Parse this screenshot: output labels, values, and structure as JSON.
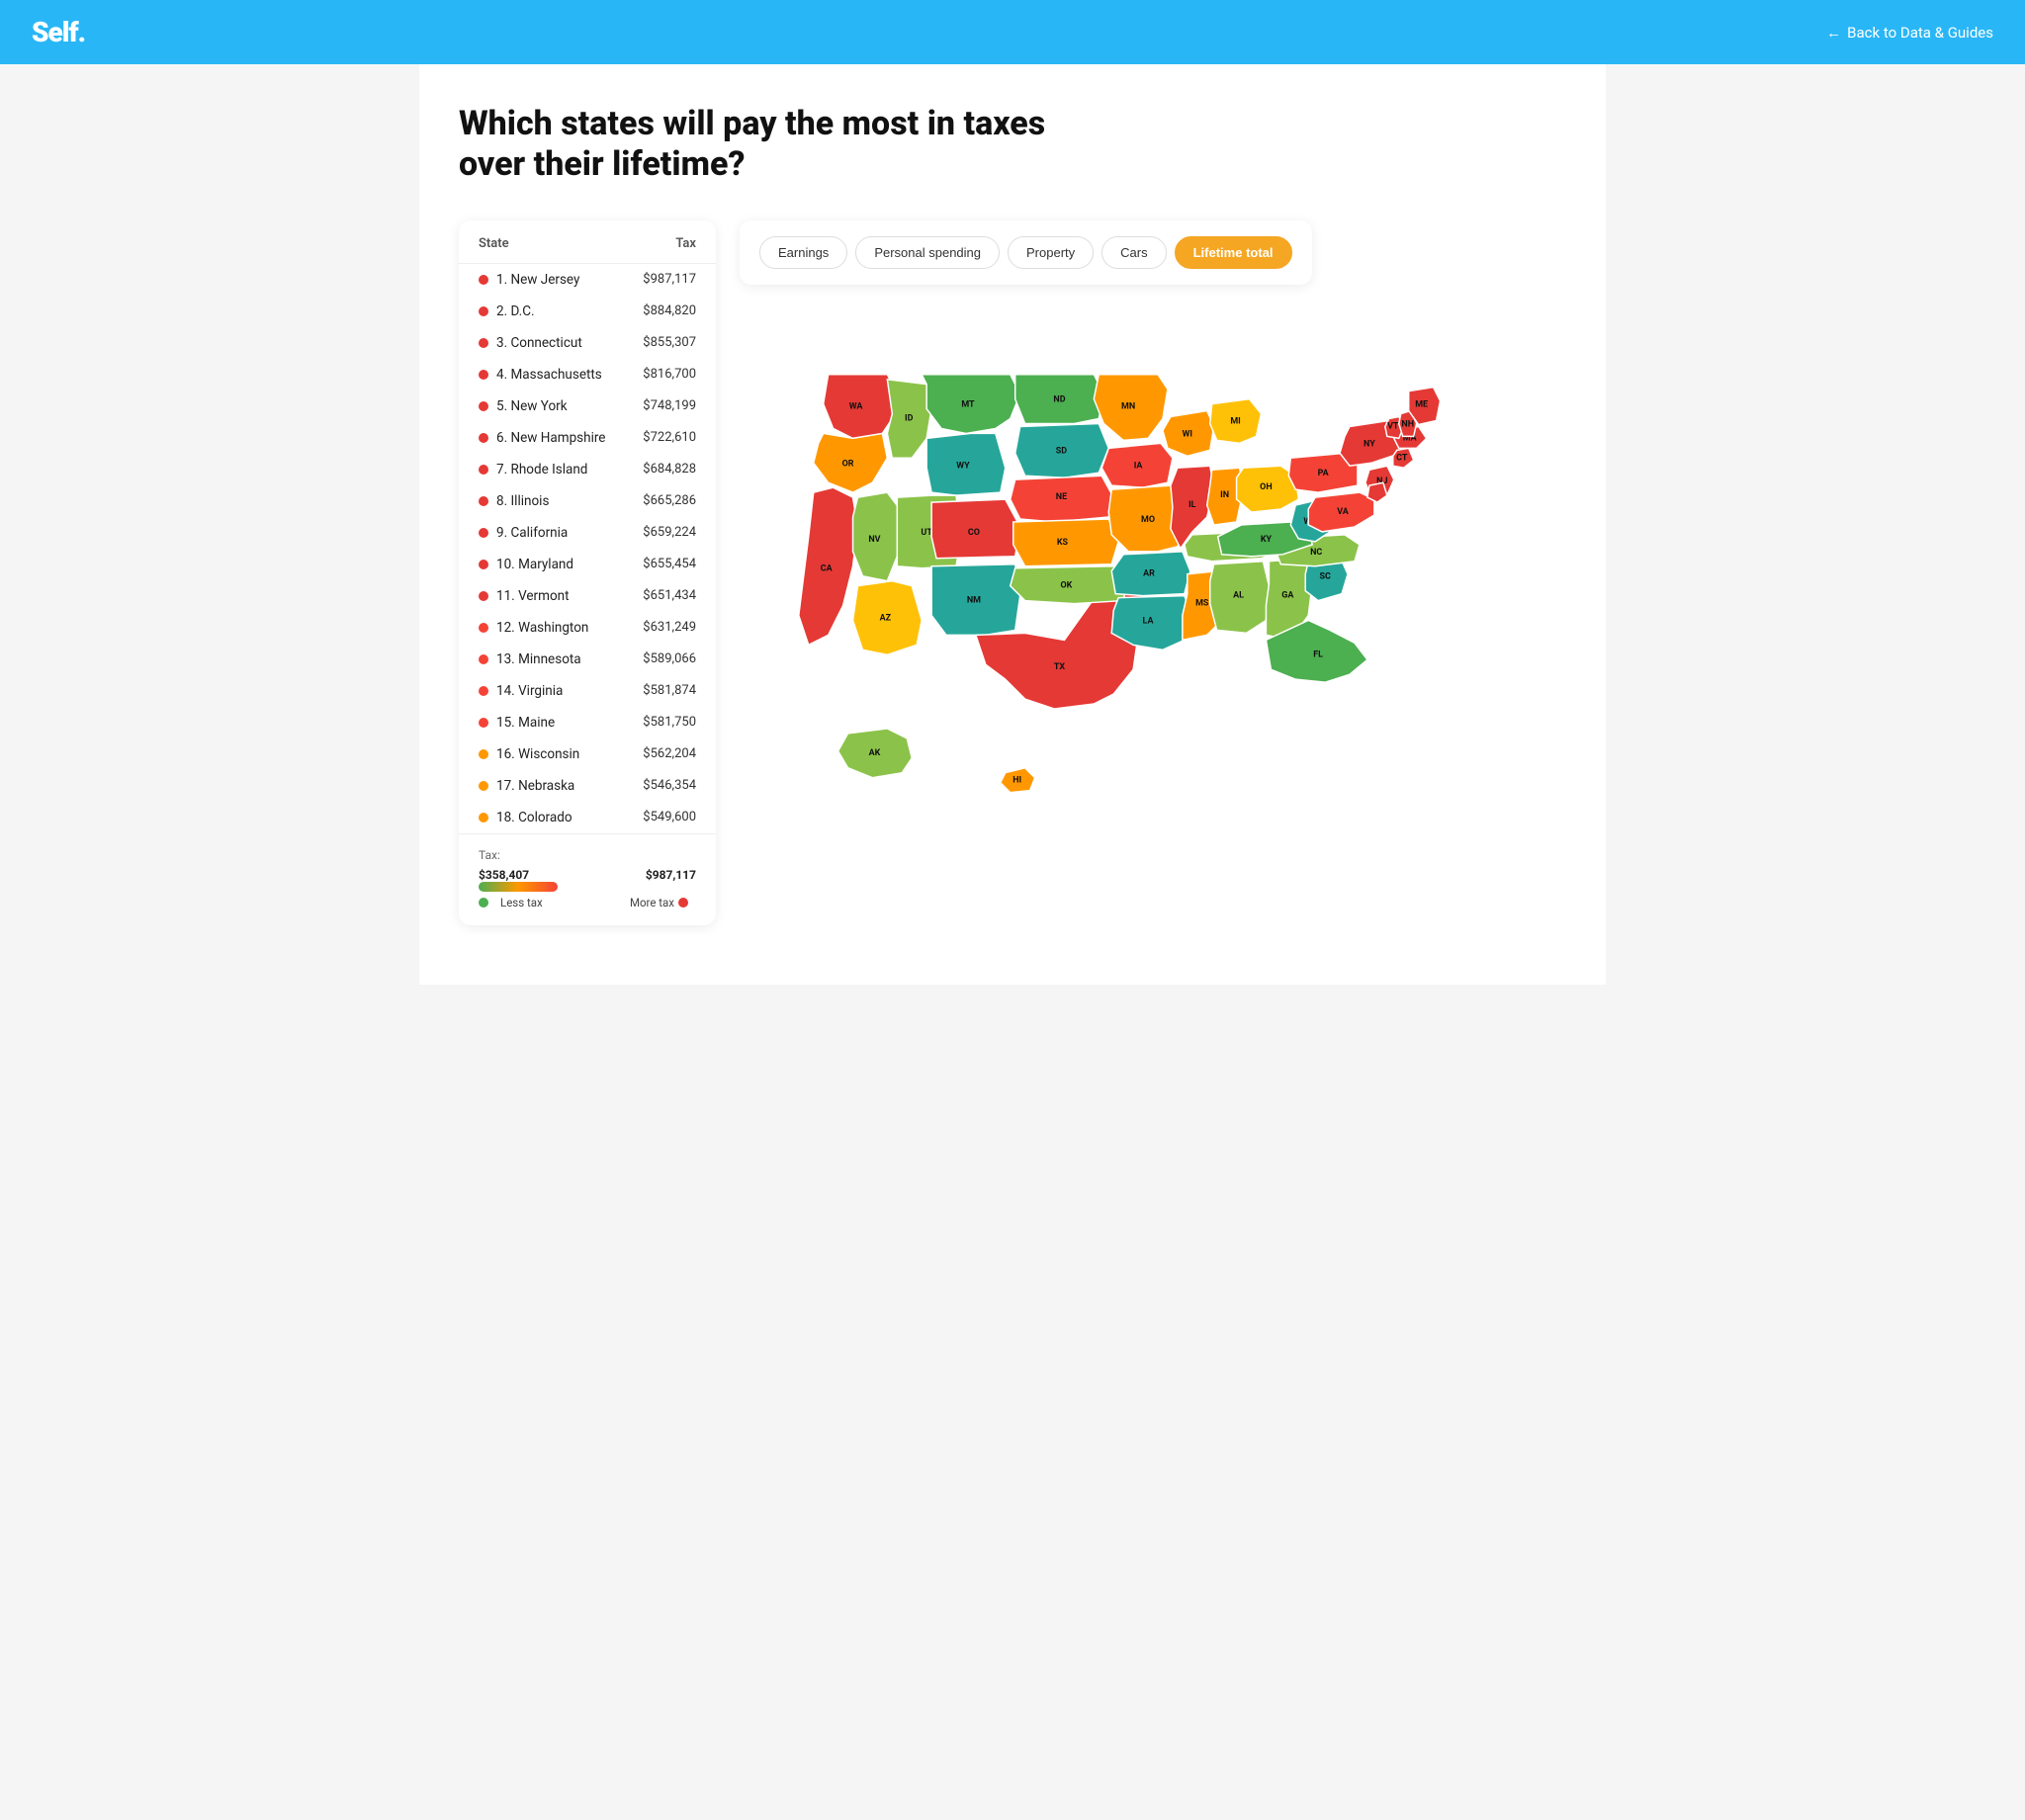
{
  "header": {
    "logo": "Self.",
    "back_label": "Back to Data & Guides"
  },
  "page": {
    "title": "Which states will pay the most in taxes over their lifetime?"
  },
  "tabs": [
    {
      "id": "earnings",
      "label": "Earnings",
      "active": false
    },
    {
      "id": "personal_spending",
      "label": "Personal spending",
      "active": false
    },
    {
      "id": "property",
      "label": "Property",
      "active": false
    },
    {
      "id": "cars",
      "label": "Cars",
      "active": false
    },
    {
      "id": "lifetime_total",
      "label": "Lifetime total",
      "active": true
    }
  ],
  "sidebar": {
    "col_state": "State",
    "col_tax": "Tax",
    "items": [
      {
        "rank": 1,
        "name": "New Jersey",
        "tax": "$987,117",
        "color": "#e53935"
      },
      {
        "rank": 2,
        "name": "D.C.",
        "tax": "$884,820",
        "color": "#e53935"
      },
      {
        "rank": 3,
        "name": "Connecticut",
        "tax": "$855,307",
        "color": "#e53935"
      },
      {
        "rank": 4,
        "name": "Massachusetts",
        "tax": "$816,700",
        "color": "#e53935"
      },
      {
        "rank": 5,
        "name": "New York",
        "tax": "$748,199",
        "color": "#e53935"
      },
      {
        "rank": 6,
        "name": "New Hampshire",
        "tax": "$722,610",
        "color": "#e53935"
      },
      {
        "rank": 7,
        "name": "Rhode Island",
        "tax": "$684,828",
        "color": "#e53935"
      },
      {
        "rank": 8,
        "name": "Illinois",
        "tax": "$665,286",
        "color": "#e53935"
      },
      {
        "rank": 9,
        "name": "California",
        "tax": "$659,224",
        "color": "#e53935"
      },
      {
        "rank": 10,
        "name": "Maryland",
        "tax": "$655,454",
        "color": "#e53935"
      },
      {
        "rank": 11,
        "name": "Vermont",
        "tax": "$651,434",
        "color": "#e53935"
      },
      {
        "rank": 12,
        "name": "Washington",
        "tax": "$631,249",
        "color": "#f44336"
      },
      {
        "rank": 13,
        "name": "Minnesota",
        "tax": "$589,066",
        "color": "#f44336"
      },
      {
        "rank": 14,
        "name": "Virginia",
        "tax": "$581,874",
        "color": "#f44336"
      },
      {
        "rank": 15,
        "name": "Maine",
        "tax": "$581,750",
        "color": "#f44336"
      },
      {
        "rank": 16,
        "name": "Wisconsin",
        "tax": "$562,204",
        "color": "#ff9800"
      },
      {
        "rank": 17,
        "name": "Nebraska",
        "tax": "$546,354",
        "color": "#ff9800"
      },
      {
        "rank": 18,
        "name": "Colorado",
        "tax": "$549,600",
        "color": "#ff9800"
      }
    ]
  },
  "legend": {
    "tax_label": "Tax:",
    "min_value": "$358,407",
    "max_value": "$987,117",
    "less_tax": "Less tax",
    "more_tax": "More tax"
  }
}
